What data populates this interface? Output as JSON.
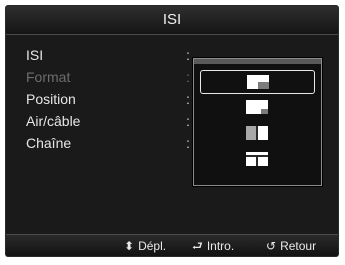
{
  "title": "ISI",
  "menu": {
    "items": [
      {
        "label": "ISI",
        "value_prefix": ": ",
        "disabled": false
      },
      {
        "label": "Format",
        "value_prefix": ":",
        "disabled": true
      },
      {
        "label": "Position",
        "value_prefix": ":",
        "disabled": false
      },
      {
        "label": "Air/câble",
        "value_prefix": ":",
        "disabled": false
      },
      {
        "label": "Chaîne",
        "value_prefix": ":",
        "disabled": false
      }
    ]
  },
  "popup": {
    "options": [
      {
        "icon": "pip-bottom-right-icon",
        "selected": true
      },
      {
        "icon": "pip-small-corner-icon",
        "selected": false
      },
      {
        "icon": "split-screen-vertical-icon",
        "selected": false
      },
      {
        "icon": "split-screen-horizontal-icon",
        "selected": false
      }
    ]
  },
  "footer": {
    "move": {
      "glyph": "⬍",
      "label": "Dépl."
    },
    "enter": {
      "glyph": "⮐",
      "label": "Intro."
    },
    "return": {
      "glyph": "↺",
      "label": "Retour"
    }
  }
}
